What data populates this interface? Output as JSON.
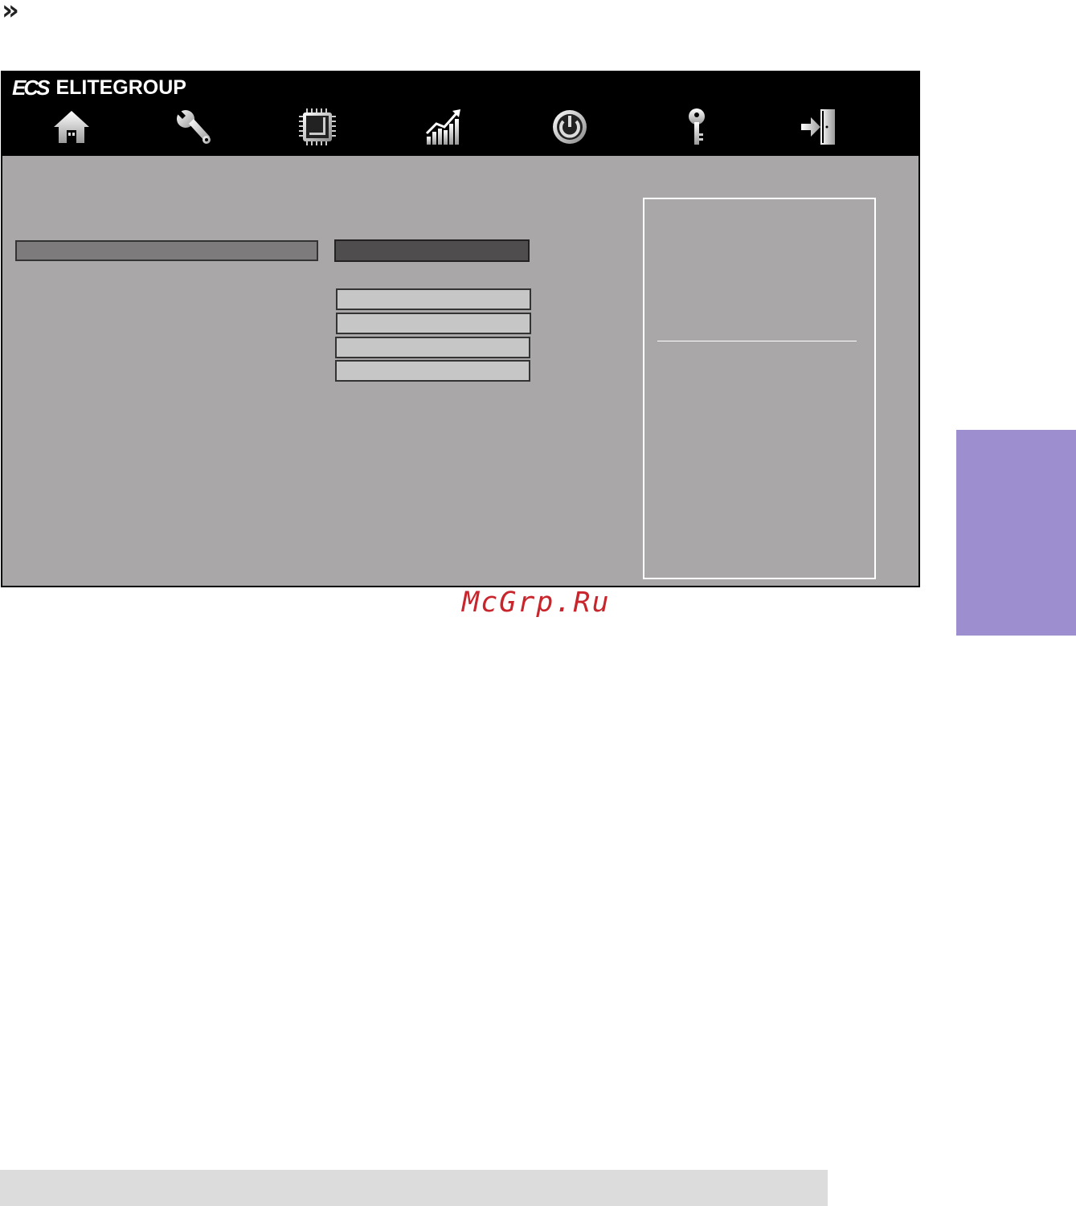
{
  "page": {
    "chevron_glyph": "»",
    "watermark": "McGrp.Ru"
  },
  "bios": {
    "logo_mark": "ECS",
    "logo_text": "ELITEGROUP",
    "nav": [
      {
        "icon": "home-icon"
      },
      {
        "icon": "wrench-icon"
      },
      {
        "icon": "chip-icon"
      },
      {
        "icon": "chart-icon"
      },
      {
        "icon": "power-icon"
      },
      {
        "icon": "key-icon"
      },
      {
        "icon": "exit-icon"
      }
    ]
  },
  "colors": {
    "topbar": "#000000",
    "panel": "#a9a7a8",
    "side_tab": "#9d8ecf",
    "watermark": "#c8262c"
  }
}
